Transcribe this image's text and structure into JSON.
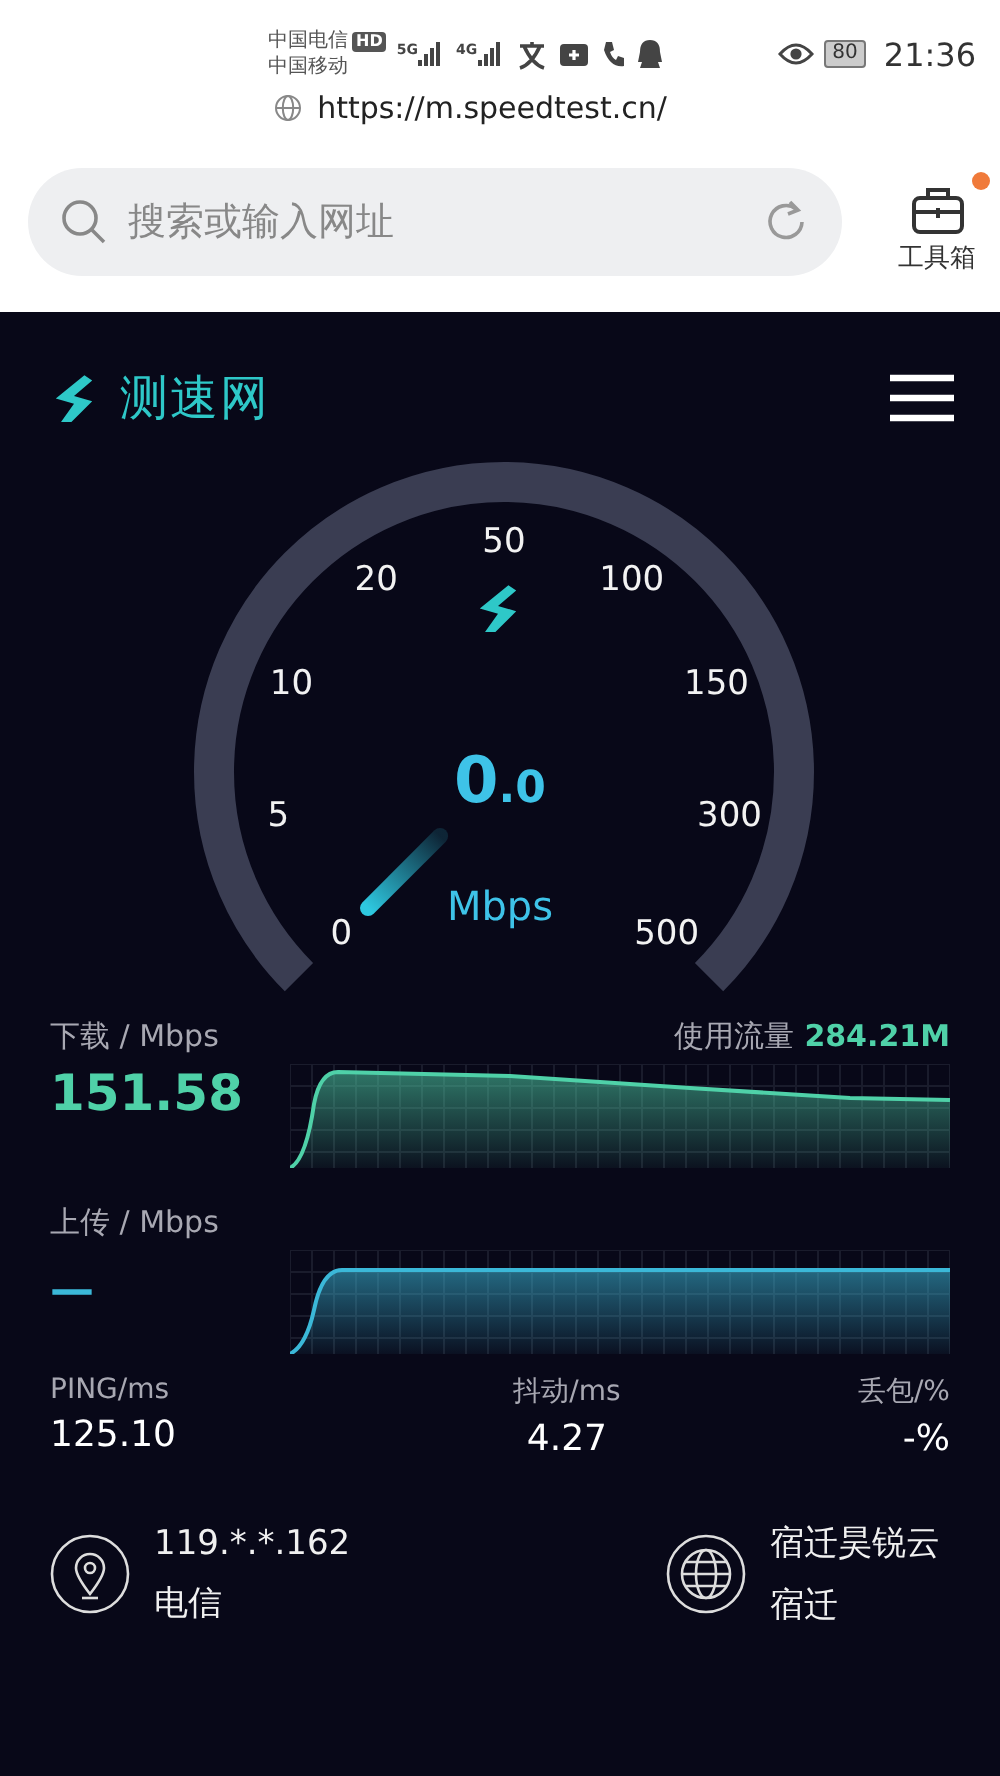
{
  "status_bar": {
    "carriers": [
      "中国电信",
      "中国移动"
    ],
    "hd_badge": "HD",
    "networks": [
      {
        "label": "5G"
      },
      {
        "label": "4G"
      }
    ],
    "battery": "80",
    "time": "21:36"
  },
  "browser": {
    "url": "https://m.speedtest.cn/",
    "search": {
      "placeholder": "搜索或输入网址"
    },
    "toolbox": {
      "label": "工具箱",
      "badge": true
    }
  },
  "app": {
    "logo": "测速网"
  },
  "gauge": {
    "scale": [
      "0",
      "5",
      "10",
      "20",
      "50",
      "100",
      "150",
      "300",
      "500"
    ],
    "reading": "0.0",
    "unit": "Mbps"
  },
  "download": {
    "label": "下载 / Mbps",
    "value": "151.58",
    "traffic_label": "使用流量",
    "traffic_value": "284.21M"
  },
  "upload": {
    "label": "上传 / Mbps",
    "value": "—"
  },
  "stats": [
    {
      "label": "PING/ms",
      "value": "125.10"
    },
    {
      "label": "抖动/ms",
      "value": "4.27"
    },
    {
      "label": "丢包/%",
      "value": "-%"
    }
  ],
  "client": {
    "ip": "119.*.*.162",
    "isp": "电信"
  },
  "server": {
    "name": "宿迁昊锐云",
    "city": "宿迁"
  }
}
